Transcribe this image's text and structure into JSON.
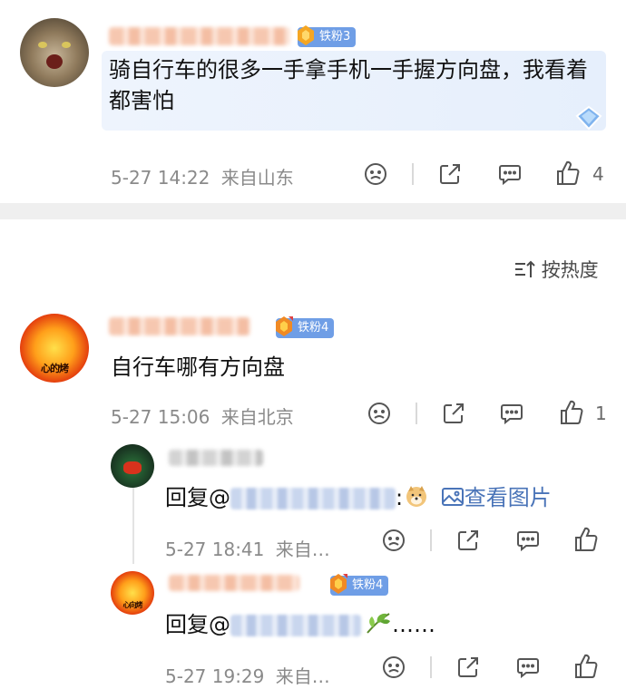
{
  "top_comment": {
    "badge": "铁粉3",
    "text": "骑自行车的很多一手拿手机一手握方向盘，我看着都害怕",
    "time": "5-27 14:22",
    "location": "来自山东",
    "like_count": "4"
  },
  "sort": {
    "label": "按热度"
  },
  "comment2": {
    "badge": "铁粉4",
    "avatar_text": "心的烤",
    "text": "自行车哪有方向盘",
    "time": "5-27 15:06",
    "location": "来自北京",
    "like_count": "1"
  },
  "reply1": {
    "prefix": "回复@",
    "colon": ":",
    "view_image": "查看图片",
    "time": "5-27 18:41",
    "location": "来自…"
  },
  "reply2": {
    "badge": "铁粉4",
    "avatar_text": "心向烤",
    "prefix": "回复@",
    "suffix": "……",
    "time": "5-27 19:29",
    "location": "来自…"
  },
  "colors": {
    "badge_bg": "#6f9ee6",
    "link": "#4a74b8",
    "meta_gray": "#8a8a8a"
  },
  "icons": [
    "dislike-icon",
    "share-icon",
    "comment-icon",
    "like-icon",
    "image-icon",
    "sort-icon",
    "doge-emoji-icon",
    "leaf-emoji-icon",
    "diamond-icon"
  ]
}
